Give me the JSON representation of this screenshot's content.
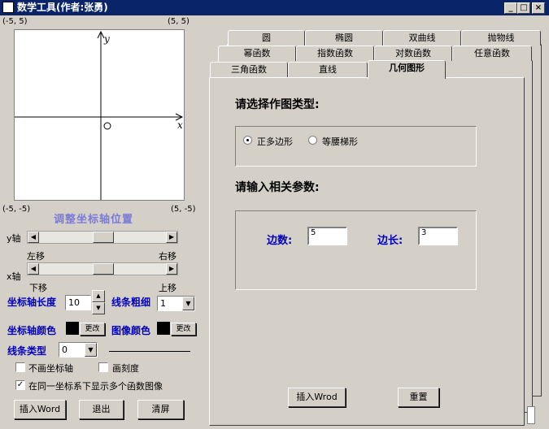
{
  "window": {
    "title": "数学工具(作者:张勇)",
    "minimize": "_",
    "maximize": "□",
    "close": "×"
  },
  "graph": {
    "corner_tl": "(-5, 5)",
    "corner_tr": "(5, 5)",
    "corner_bl": "(-5, -5)",
    "corner_br": "(5, -5)",
    "axis_x": "x",
    "axis_y": "y"
  },
  "adjust_title": "调整坐标轴位置",
  "yaxis": {
    "label": "y轴",
    "left": "左移",
    "right": "右移"
  },
  "xaxis": {
    "label": "x轴",
    "down": "下移",
    "up": "上移"
  },
  "axis_length": {
    "label": "坐标轴长度",
    "value": "10"
  },
  "line_width": {
    "label": "线条粗细",
    "value": "1"
  },
  "axis_color": {
    "label": "坐标轴颜色",
    "button": "更改",
    "color": "#000000"
  },
  "image_color": {
    "label": "图像颜色",
    "button": "更改",
    "color": "#000000"
  },
  "line_type": {
    "label": "线条类型",
    "value": "0"
  },
  "checks": {
    "no_axis": "不画坐标轴",
    "draw_ticks": "画刻度",
    "multi": "在同一坐标系下显示多个函数图像"
  },
  "buttons": {
    "insert_word": "插入Word",
    "exit": "退出",
    "clear": "清屏"
  },
  "tabs": {
    "row1": [
      "圆",
      "椭圆",
      "双曲线",
      "抛物线"
    ],
    "row2": [
      "幂函数",
      "指数函数",
      "对数函数",
      "任意函数"
    ],
    "row3": [
      "三角函数",
      "直线",
      "几何图形"
    ]
  },
  "geometry": {
    "heading_type": "请选择作图类型:",
    "option1": "正多边形",
    "option2": "等腰梯形",
    "heading_params": "请输入相关参数:",
    "sides_label": "边数:",
    "sides_value": "5",
    "length_label": "边长:",
    "length_value": "3",
    "insert_button": "插入Wrod",
    "reset_button": "重置"
  }
}
